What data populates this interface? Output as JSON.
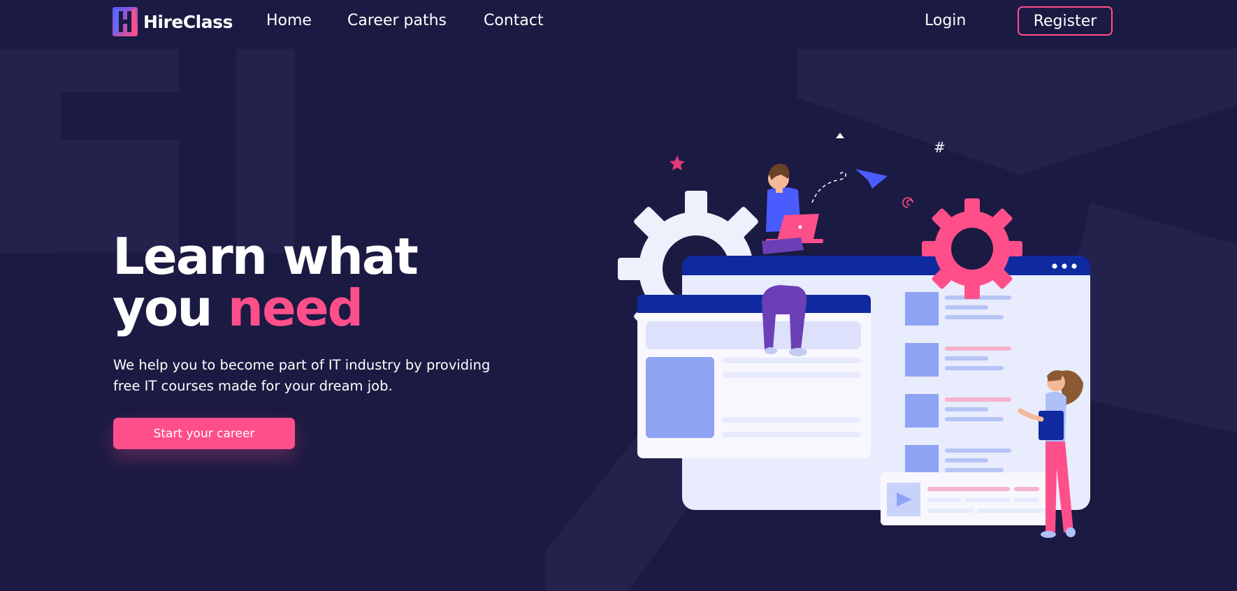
{
  "brand": {
    "name": "HireClass",
    "logo_icon": "hireclass-logo-icon"
  },
  "nav": {
    "links": [
      "Home",
      "Career paths",
      "Contact"
    ],
    "login": "Login",
    "register": "Register"
  },
  "hero": {
    "title_line1": "Learn what",
    "title_line2_plain": "you",
    "title_line2_accent": "need",
    "description": "We help you to become part of IT industry by providing free IT courses made for your dream job.",
    "cta": "Start your career"
  },
  "colors": {
    "background": "#1b1a42",
    "accent": "#ff4f8b",
    "primary_blue": "#0f2a9e",
    "soft_blue": "#8fa3f3"
  },
  "icons": [
    "gear-icon",
    "paper-plane-icon",
    "star-icon",
    "hashtag-icon",
    "play-icon",
    "laptop-icon"
  ]
}
